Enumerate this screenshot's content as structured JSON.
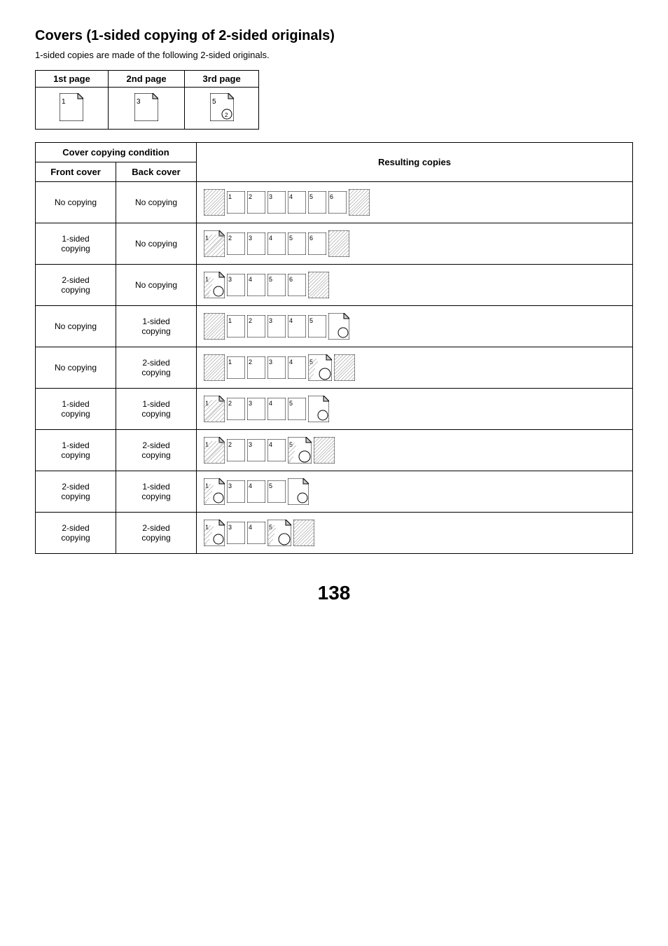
{
  "title": "Covers (1-sided copying of 2-sided originals)",
  "subtitle": "1-sided copies are made of the following 2-sided originals.",
  "originals": {
    "headers": [
      "1st page",
      "2nd page",
      "3rd page"
    ],
    "page_numbers": [
      "1",
      "3",
      "5"
    ]
  },
  "table": {
    "header_condition": "Cover copying condition",
    "header_resulting": "Resulting copies",
    "subheader_front": "Front cover",
    "subheader_back": "Back cover"
  },
  "rows": [
    {
      "front": "No copying",
      "back": "No copying"
    },
    {
      "front": "1-sided\ncopying",
      "back": "No copying"
    },
    {
      "front": "2-sided\ncopying",
      "back": "No copying"
    },
    {
      "front": "No copying",
      "back": "1-sided\ncopying"
    },
    {
      "front": "No copying",
      "back": "2-sided\ncopying"
    },
    {
      "front": "1-sided\ncopying",
      "back": "1-sided\ncopying"
    },
    {
      "front": "1-sided\ncopying",
      "back": "2-sided\ncopying"
    },
    {
      "front": "2-sided\ncopying",
      "back": "1-sided\ncopying"
    },
    {
      "front": "2-sided\ncopying",
      "back": "2-sided\ncopying"
    }
  ],
  "page_number": "138"
}
